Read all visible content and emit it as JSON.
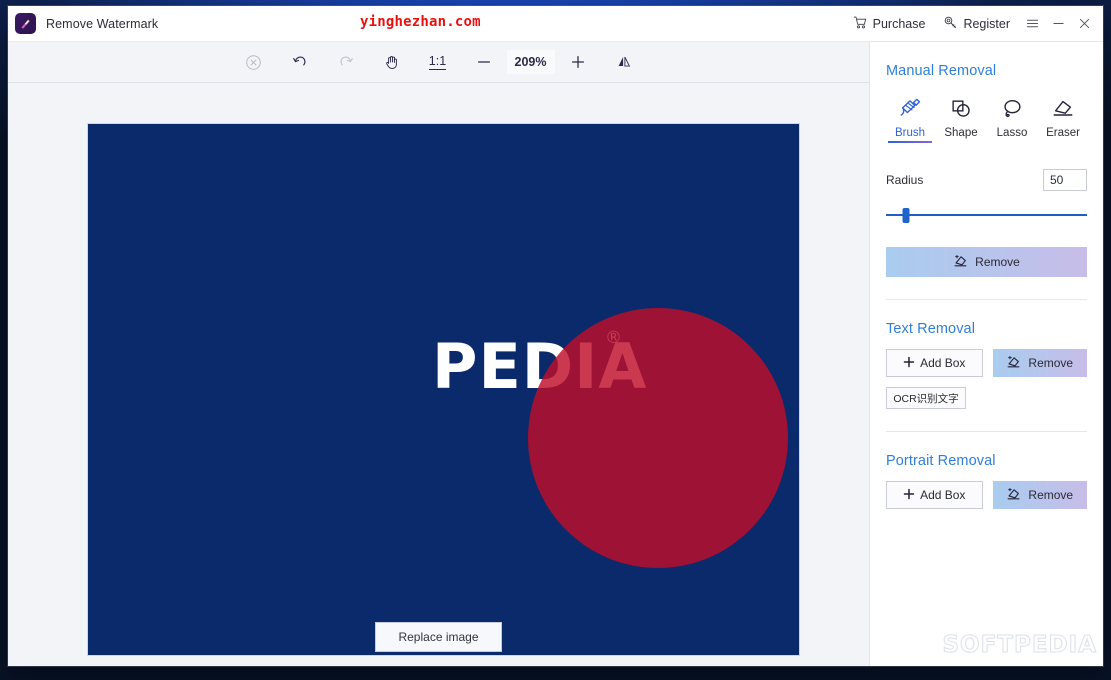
{
  "window": {
    "app_icon": "brush-app-icon",
    "title": "Remove Watermark",
    "site_watermark": "yinghezhan.com",
    "purchase_label": "Purchase",
    "purchase_icon": "shopping-cart-icon",
    "register_label": "Register",
    "register_icon": "key-icon",
    "menu_icon": "hamburger-menu-icon",
    "minimize_icon": "minimize-icon",
    "close_icon": "close-icon"
  },
  "editor": {
    "toolbar": {
      "cancel_icon": "circle-x-icon",
      "undo_icon": "undo-arrow-icon",
      "redo_icon": "redo-arrow-icon",
      "pan_icon": "hand-pan-icon",
      "actual_size_label": "1:1",
      "zoom_out_icon": "minus-icon",
      "zoom_value": "209%",
      "zoom_in_icon": "plus-icon",
      "flip_icon": "flip-horizontal-icon"
    },
    "canvas": {
      "image_text": "PEDIA",
      "image_registered_mark": "®",
      "background_color": "#0a2a6b",
      "mask_color": "#be0e2a"
    },
    "replace_image_label": "Replace image"
  },
  "panel": {
    "manual": {
      "title": "Manual Removal",
      "tools": [
        {
          "label": "Brush",
          "icon": "brush-icon",
          "active": true
        },
        {
          "label": "Shape",
          "icon": "shape-icon",
          "active": false
        },
        {
          "label": "Lasso",
          "icon": "lasso-icon",
          "active": false
        },
        {
          "label": "Eraser",
          "icon": "eraser-icon",
          "active": false
        }
      ],
      "radius_label": "Radius",
      "radius_value": "50",
      "remove_label": "Remove",
      "remove_icon": "eraser-sparkle-icon"
    },
    "text": {
      "title": "Text Removal",
      "add_box_label": "Add Box",
      "add_box_icon": "plus-icon",
      "remove_label": "Remove",
      "remove_icon": "eraser-sparkle-icon",
      "ocr_label": "OCR识别文字"
    },
    "portrait": {
      "title": "Portrait Removal",
      "add_box_label": "Add Box",
      "add_box_icon": "plus-icon",
      "remove_label": "Remove",
      "remove_icon": "eraser-sparkle-icon"
    },
    "brand_watermark": "SOFTPEDIA"
  },
  "colors": {
    "accent_blue": "#2f7fd8",
    "active_tab": "#2f63d8",
    "canvas_navy": "#0a2a6b",
    "mask_red": "#be0e2a",
    "watermark_red": "#e8110f"
  }
}
